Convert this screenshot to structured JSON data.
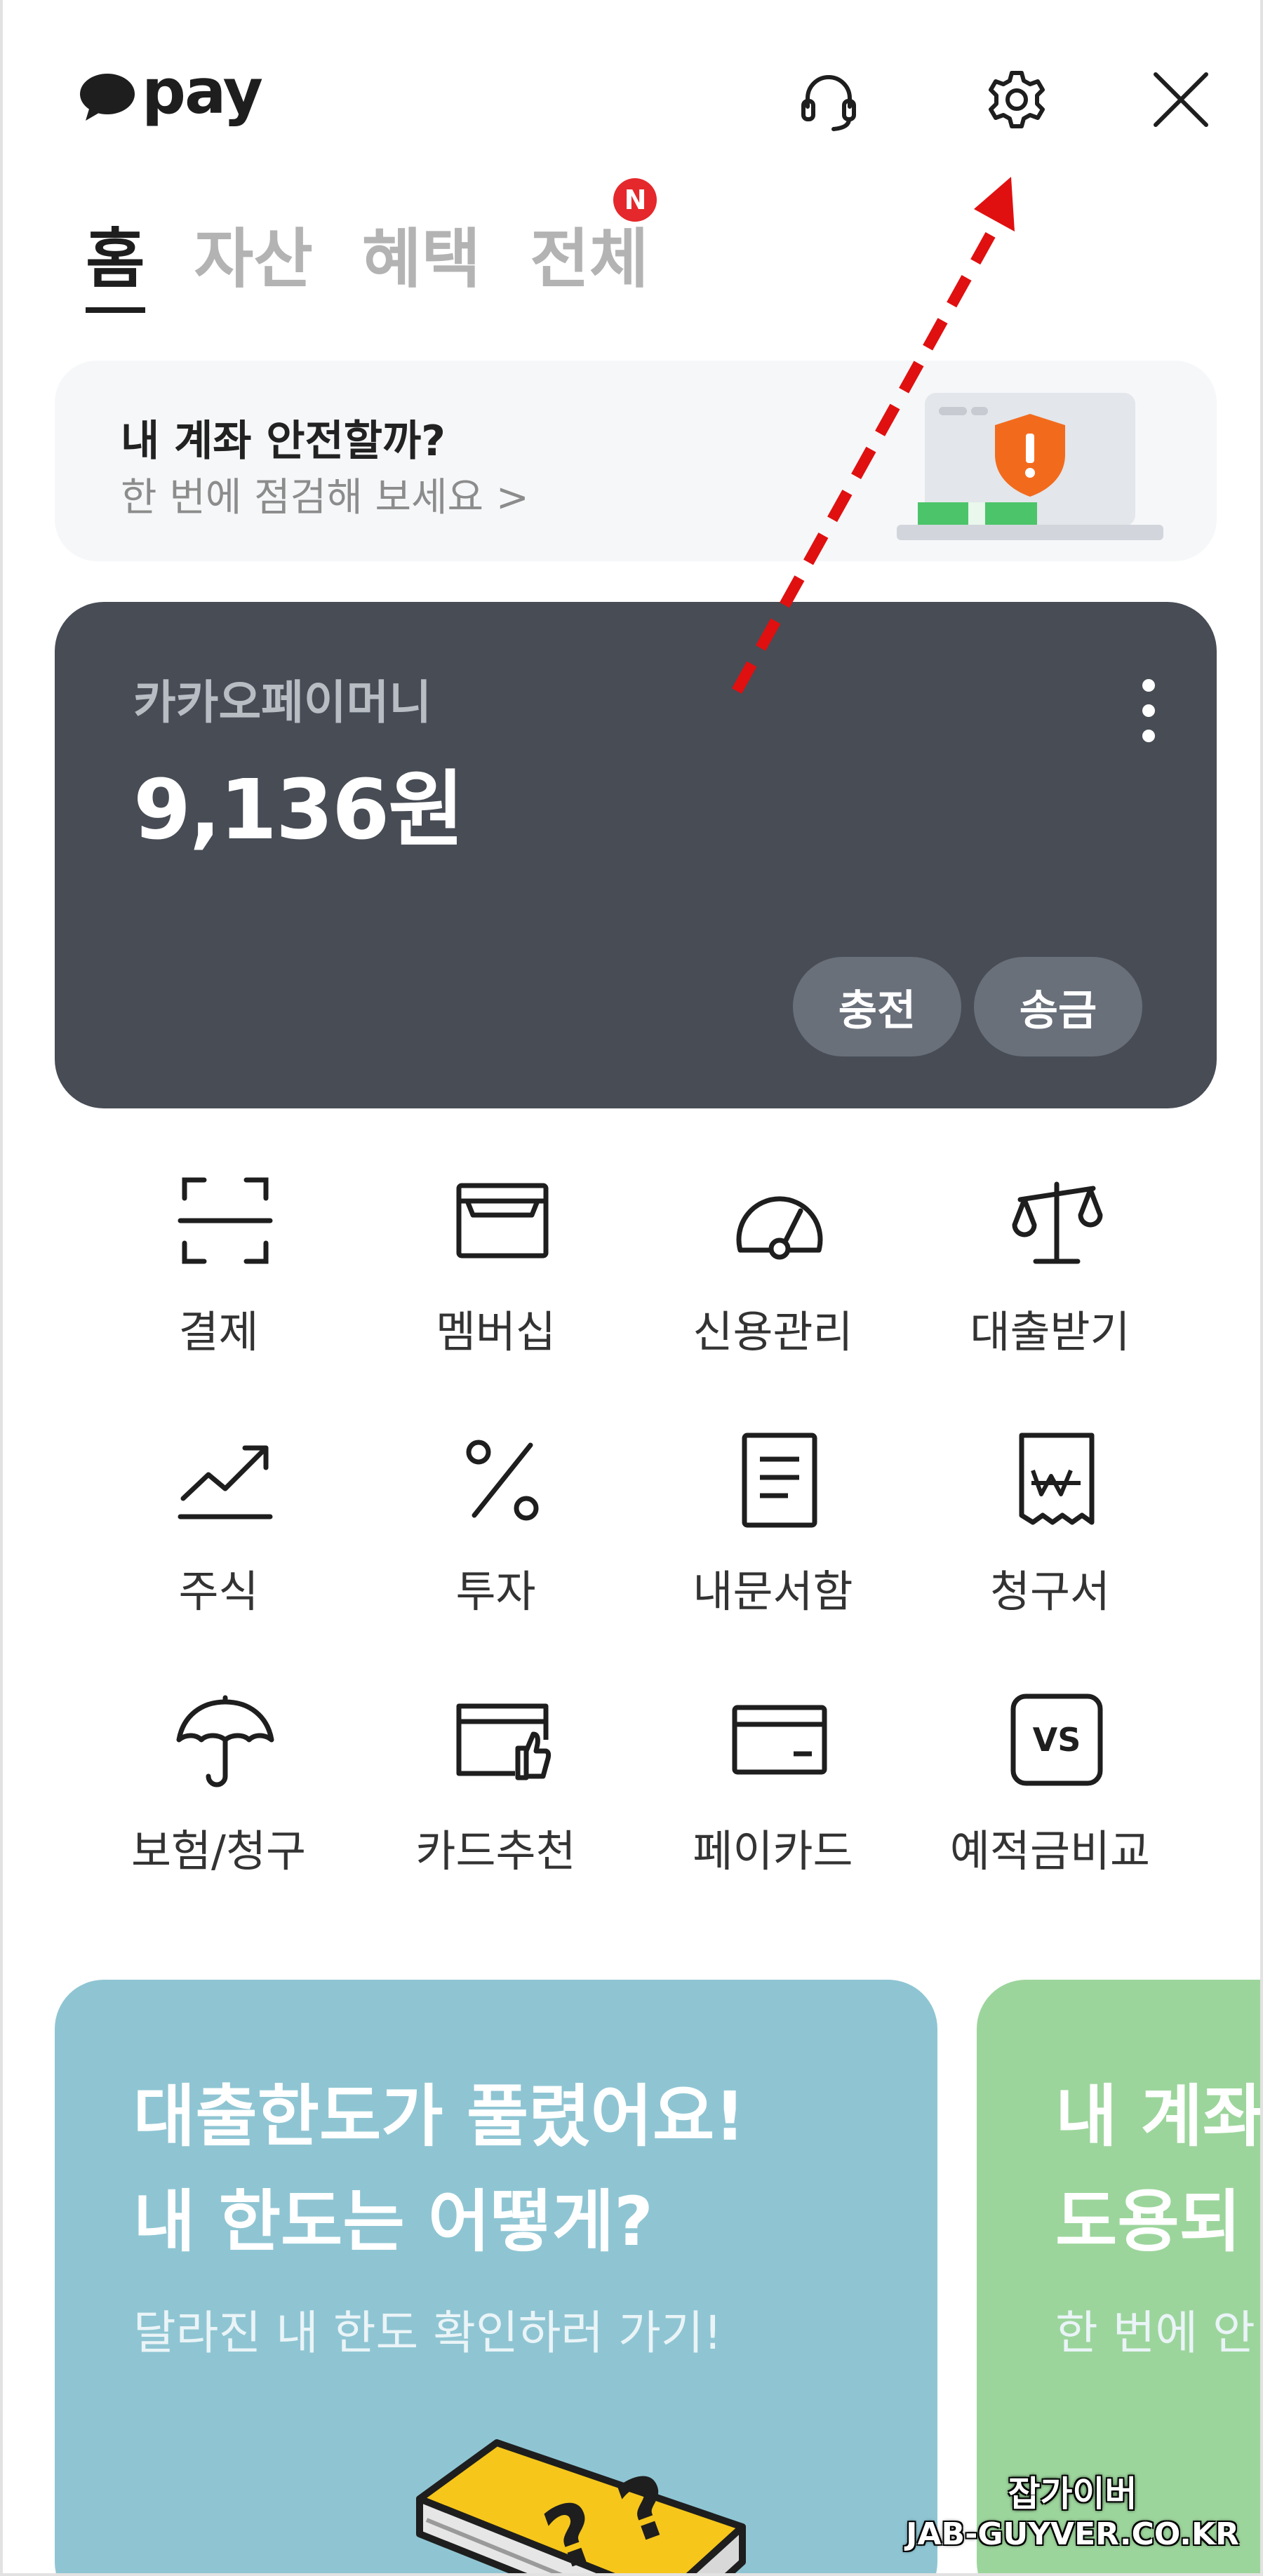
{
  "header": {
    "logo_text": "pay",
    "icons": [
      "support-headset-icon",
      "settings-gear-icon",
      "close-icon"
    ]
  },
  "tabs": [
    {
      "label": "홈",
      "active": true
    },
    {
      "label": "자산",
      "active": false
    },
    {
      "label": "혜택",
      "active": false
    },
    {
      "label": "전체",
      "active": false,
      "badge": "N"
    }
  ],
  "security_banner": {
    "title": "내 계좌 안전할까?",
    "subtitle": "한 번에 점검해 보세요 >"
  },
  "money_card": {
    "label": "카카오페이머니",
    "amount": "9,136원",
    "buttons": [
      "충전",
      "송금"
    ]
  },
  "menu": [
    {
      "label": "결제",
      "icon": "scan-icon"
    },
    {
      "label": "멤버십",
      "icon": "wallet-icon"
    },
    {
      "label": "신용관리",
      "icon": "gauge-icon"
    },
    {
      "label": "대출받기",
      "icon": "scale-icon"
    },
    {
      "label": "주식",
      "icon": "chart-icon"
    },
    {
      "label": "투자",
      "icon": "percent-icon"
    },
    {
      "label": "내문서함",
      "icon": "document-icon"
    },
    {
      "label": "청구서",
      "icon": "bill-icon"
    },
    {
      "label": "보험/청구",
      "icon": "umbrella-icon"
    },
    {
      "label": "카드추천",
      "icon": "card-thumb-icon"
    },
    {
      "label": "페이카드",
      "icon": "card-icon"
    },
    {
      "label": "예적금비교",
      "icon": "vs-icon"
    }
  ],
  "promos": [
    {
      "title_line1": "대출한도가 풀렸어요!",
      "title_line2": "내 한도는 어떻게?",
      "subtitle": "달라진 내 한도 확인하러 가기!"
    },
    {
      "title_line1": "내 계좌",
      "title_line2": "도용되",
      "subtitle": "한 번에 안"
    }
  ],
  "watermark": {
    "line1": "잡가이버",
    "line2": "JAB-GUYVER.CO.KR"
  },
  "colors": {
    "card_bg": "#474c55",
    "accent_red": "#e5282c",
    "promo_blue": "#8fc5d3",
    "promo_green": "#9cd59c"
  }
}
